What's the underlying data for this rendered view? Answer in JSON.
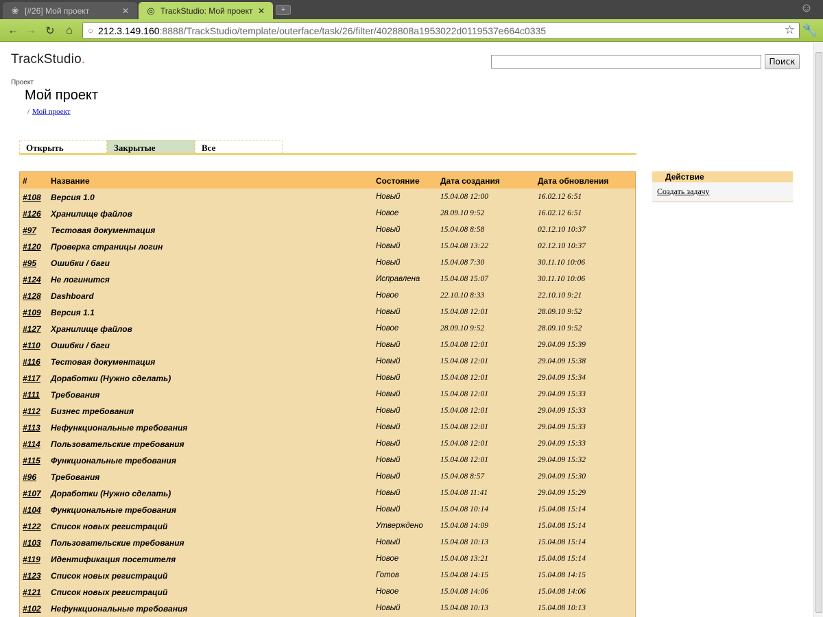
{
  "browser": {
    "tabs": [
      {
        "title": "[#26] Мой проект",
        "active": false
      },
      {
        "title": "TrackStudio: Мой проект",
        "active": true
      }
    ],
    "url_host": "212.3.149.160",
    "url_path": ":8888/TrackStudio/template/outerface/task/26/filter/4028808a1953022d0119537e664c0335"
  },
  "header": {
    "logo": "TrackStudio",
    "logo_dot": ".",
    "search_placeholder": "",
    "search_button": "Поиск"
  },
  "project": {
    "label": "Проект",
    "title": "Мой проект",
    "breadcrumb_sep": "/",
    "breadcrumb_link": "Мой проект"
  },
  "filter_tabs": [
    "Открыть",
    "Закрытые",
    "Все"
  ],
  "table": {
    "columns": [
      "#",
      "Название",
      "Состояние",
      "Дата создания",
      "Дата обновления"
    ],
    "rows": [
      [
        "#108",
        "Версия 1.0",
        "Новый",
        "15.04.08 12:00",
        "16.02.12 6:51"
      ],
      [
        "#126",
        "Хранилище файлов",
        "Новое",
        "28.09.10 9:52",
        "16.02.12 6:51"
      ],
      [
        "#97",
        "Тестовая документация",
        "Новый",
        "15.04.08 8:58",
        "02.12.10 10:37"
      ],
      [
        "#120",
        "Проверка страницы логин",
        "Новый",
        "15.04.08 13:22",
        "02.12.10 10:37"
      ],
      [
        "#95",
        "Ошибки / баги",
        "Новый",
        "15.04.08 7:30",
        "30.11.10 10:06"
      ],
      [
        "#124",
        "Не логинится",
        "Исправлена",
        "15.04.08 15:07",
        "30.11.10 10:06"
      ],
      [
        "#128",
        "Dashboard",
        "Новое",
        "22.10.10 8:33",
        "22.10.10 9:21"
      ],
      [
        "#109",
        "Версия 1.1",
        "Новый",
        "15.04.08 12:01",
        "28.09.10 9:52"
      ],
      [
        "#127",
        "Хранилище файлов",
        "Новое",
        "28.09.10 9:52",
        "28.09.10 9:52"
      ],
      [
        "#110",
        "Ошибки / баги",
        "Новый",
        "15.04.08 12:01",
        "29.04.09 15:39"
      ],
      [
        "#116",
        "Тестовая документация",
        "Новый",
        "15.04.08 12:01",
        "29.04.09 15:38"
      ],
      [
        "#117",
        "Доработки (Нужно сделать)",
        "Новый",
        "15.04.08 12:01",
        "29.04.09 15:34"
      ],
      [
        "#111",
        "Требования",
        "Новый",
        "15.04.08 12:01",
        "29.04.09 15:33"
      ],
      [
        "#112",
        "Бизнес требования",
        "Новый",
        "15.04.08 12:01",
        "29.04.09 15:33"
      ],
      [
        "#113",
        "Нефункциональные требования",
        "Новый",
        "15.04.08 12:01",
        "29.04.09 15:33"
      ],
      [
        "#114",
        "Пользовательские требования",
        "Новый",
        "15.04.08 12:01",
        "29.04.09 15:33"
      ],
      [
        "#115",
        "Функциональные требования",
        "Новый",
        "15.04.08 12:01",
        "29.04.09 15:32"
      ],
      [
        "#96",
        "Требования",
        "Новый",
        "15.04.08 8:57",
        "29.04.09 15:30"
      ],
      [
        "#107",
        "Доработки (Нужно сделать)",
        "Новый",
        "15.04.08 11:41",
        "29.04.09 15:29"
      ],
      [
        "#104",
        "Функциональные требования",
        "Новый",
        "15.04.08 10:14",
        "15.04.08 15:14"
      ],
      [
        "#122",
        "Список новых регистраций",
        "Утверждено",
        "15.04.08 14:09",
        "15.04.08 15:14"
      ],
      [
        "#103",
        "Пользовательские требования",
        "Новый",
        "15.04.08 10:13",
        "15.04.08 15:14"
      ],
      [
        "#119",
        "Идентификация посетителя",
        "Новое",
        "15.04.08 13:21",
        "15.04.08 15:14"
      ],
      [
        "#123",
        "Список новых регистраций",
        "Готов",
        "15.04.08 14:15",
        "15.04.08 14:15"
      ],
      [
        "#121",
        "Список новых регистраций",
        "Новое",
        "15.04.08 14:06",
        "15.04.08 14:06"
      ],
      [
        "#102",
        "Нефункциональные требования",
        "Новый",
        "15.04.08 10:13",
        "15.04.08 10:13"
      ]
    ]
  },
  "actions": {
    "header": "Действие",
    "create_task": "Создать задачу"
  }
}
